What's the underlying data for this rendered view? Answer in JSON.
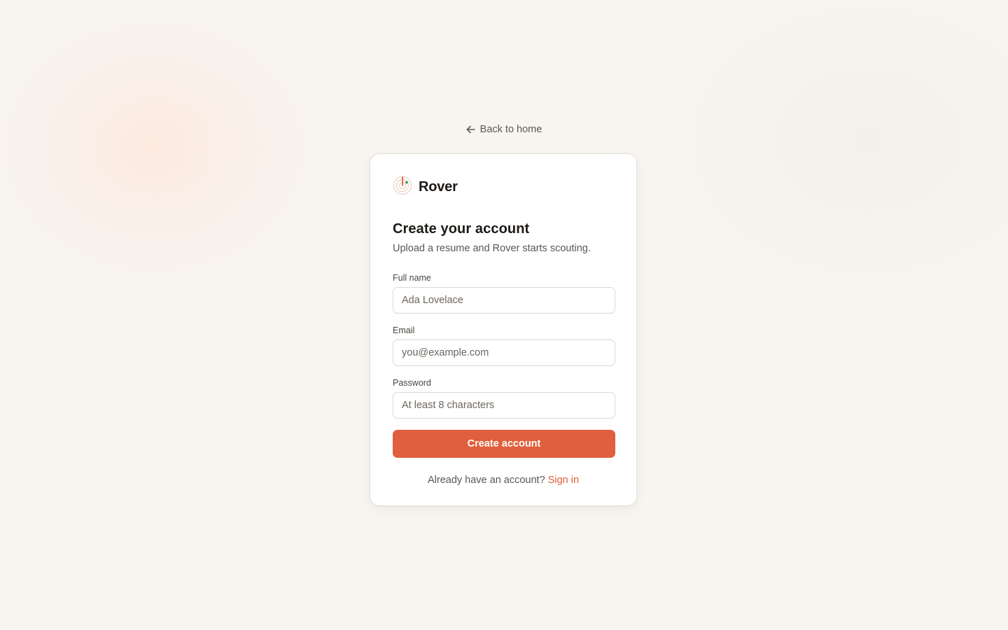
{
  "nav": {
    "back_label": "Back to home",
    "back_icon": "arrow-left-icon"
  },
  "brand": {
    "name": "Rover",
    "logo_icon": "radar-logo-icon"
  },
  "form": {
    "title": "Create your account",
    "subtitle": "Upload a resume and Rover starts scouting.",
    "fields": [
      {
        "label": "Full name",
        "value": "",
        "placeholder": "Ada Lovelace"
      },
      {
        "label": "Email",
        "value": "",
        "placeholder": "you@example.com"
      },
      {
        "label": "Password",
        "value": "",
        "placeholder": "At least 8 characters"
      }
    ],
    "submit_label": "Create account"
  },
  "footer": {
    "prompt": "Already have an account?",
    "signin_label": "Sign in"
  },
  "colors": {
    "accent": "#e05f3c",
    "background": "#f8f5f1",
    "card": "#ffffff",
    "logo_dot": "#2fa36b"
  }
}
